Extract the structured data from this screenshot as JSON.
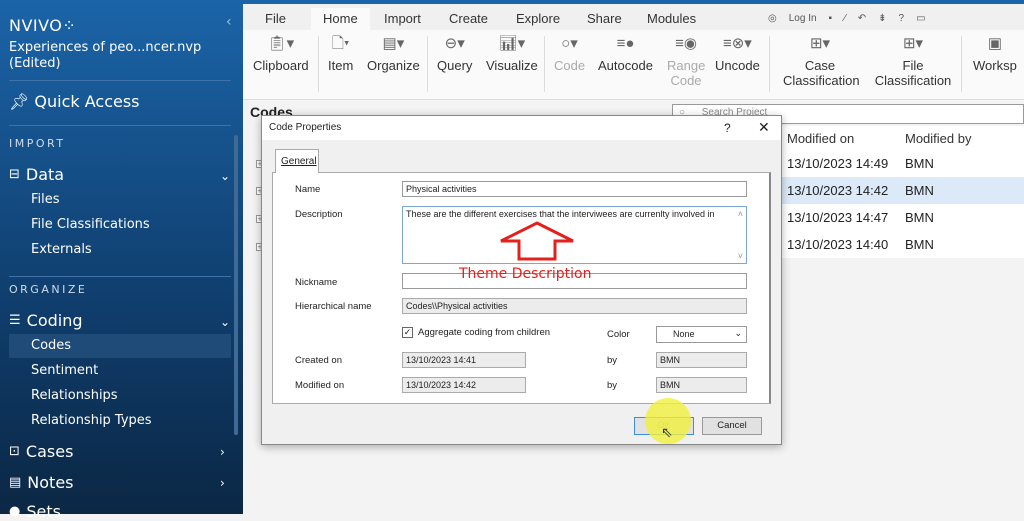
{
  "sidebar": {
    "logo": "NVIVO",
    "logo_mark": "⁘",
    "project": "Experiences of peo...ncer.nvp",
    "edited": "(Edited)",
    "quick_access": "Quick Access",
    "sections": [
      {
        "title": "IMPORT"
      },
      {
        "title": "ORGANIZE"
      }
    ],
    "data": {
      "label": "Data",
      "items": [
        "Files",
        "File Classifications",
        "Externals"
      ]
    },
    "coding": {
      "label": "Coding",
      "items": [
        "Codes",
        "Sentiment",
        "Relationships",
        "Relationship Types"
      ]
    },
    "cases": "Cases",
    "notes": "Notes",
    "sets": "Sets"
  },
  "ribbon": {
    "tabs": [
      "File",
      "Home",
      "Import",
      "Create",
      "Explore",
      "Share",
      "Modules"
    ],
    "active_tab": "Home",
    "login": "Log In",
    "help": "?",
    "buttons": [
      "Clipboard",
      "Item",
      "Organize",
      "Query",
      "Visualize",
      "Code",
      "Autocode",
      "Range Code",
      "Uncode",
      "Case Classification",
      "File Classification",
      "Worksp"
    ]
  },
  "content": {
    "title": "Codes",
    "search_placeholder": "Search Project",
    "columns": [
      "Modified on",
      "Modified by"
    ],
    "rows": [
      [
        "13/10/2023 14:49",
        "BMN"
      ],
      [
        "13/10/2023 14:42",
        "BMN"
      ],
      [
        "13/10/2023 14:47",
        "BMN"
      ],
      [
        "13/10/2023 14:40",
        "BMN"
      ]
    ]
  },
  "dialog": {
    "title": "Code Properties",
    "help": "?",
    "close": "✕",
    "tab": "General",
    "name_label": "Name",
    "name": "Physical activities",
    "description_label": "Description",
    "description": "These are the different exercises that the interviwees are currenlty involved in",
    "nickname_label": "Nickname",
    "nickname": "",
    "hier_label": "Hierarchical name",
    "hier": "Codes\\\\Physical activities",
    "aggregate_label": "Aggregate coding from children",
    "aggregate_checked": true,
    "color_label": "Color",
    "color": "None",
    "created_label": "Created on",
    "created": "13/10/2023 14:41",
    "by_label": "by",
    "created_by": "BMN",
    "modified_label": "Modified on",
    "modified": "13/10/2023 14:42",
    "modified_by": "BMN",
    "ok": "OK",
    "cancel": "Cancel"
  },
  "annotation": {
    "text": "Theme Description",
    "color": "#e3201b"
  },
  "colors": {
    "sidebar": "#1b64a8",
    "selected_row": "#dbe9f8"
  }
}
